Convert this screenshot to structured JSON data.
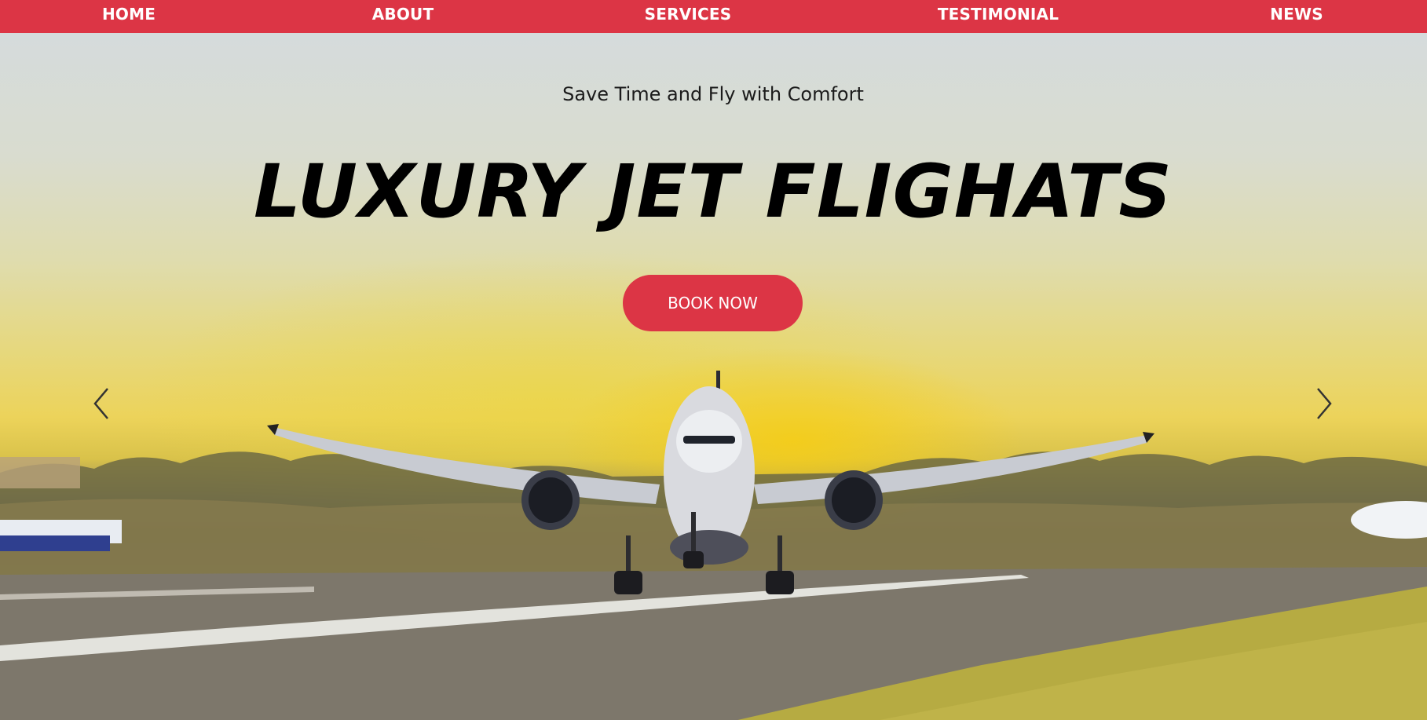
{
  "nav": {
    "items": [
      {
        "label": "HOME"
      },
      {
        "label": "ABOUT"
      },
      {
        "label": "SERVICES"
      },
      {
        "label": "TESTIMONIAL"
      },
      {
        "label": "NEWS"
      }
    ]
  },
  "hero": {
    "subtitle": "Save Time and Fly with Comfort",
    "headline": "LUXURY JET FLIGHATS",
    "cta_label": "BOOK NOW"
  },
  "carousel": {
    "prev_icon": "chevron-left-icon",
    "next_icon": "chevron-right-icon"
  },
  "colors": {
    "accent": "#dc3545",
    "nav_text": "#ffffff",
    "headline": "#000000"
  }
}
